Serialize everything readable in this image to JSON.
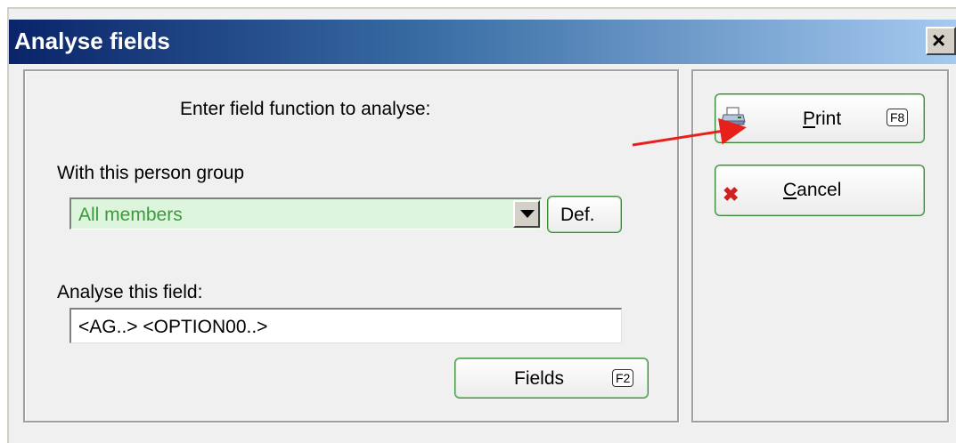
{
  "window": {
    "title": "Analyse fields",
    "close_glyph": "×"
  },
  "form": {
    "prompt": "Enter field function to analyse:",
    "group_label": "With this person group",
    "group_value": "All members",
    "def_button": "Def.",
    "field_label": "Analyse this field:",
    "field_value": "<AG..> <OPTION00..>",
    "fields_button": "Fields",
    "fields_key": "F2"
  },
  "actions": {
    "print_prefix": "P",
    "print_rest": "rint",
    "print_key": "F8",
    "print_icon": "printer-icon",
    "cancel_prefix": "C",
    "cancel_rest": "ancel",
    "cancel_icon": "cancel-x-icon"
  },
  "annotation": {
    "arrow_color": "#e8201c"
  },
  "colors": {
    "title_gradient_start": "#0a246a",
    "title_gradient_end": "#a6caf0",
    "combo_bg": "#dcf5dc",
    "combo_text": "#3c9a3c",
    "button_border": "#3a8a3a"
  }
}
